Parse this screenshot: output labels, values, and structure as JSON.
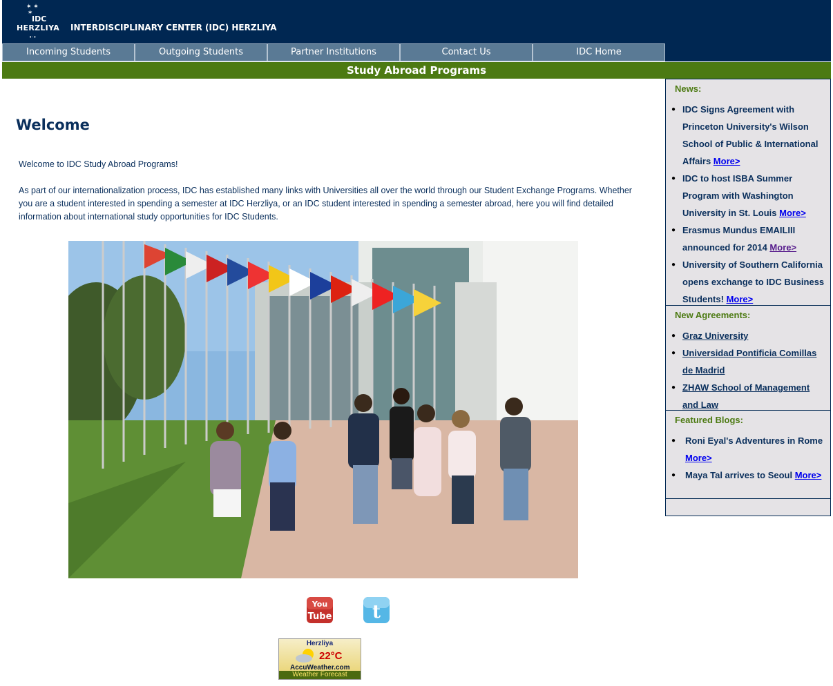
{
  "header": {
    "logo_line1": "IDC",
    "logo_line2": "HERZLIYA",
    "title": "INTERDISCIPLINARY CENTER (IDC) HERZLIYA"
  },
  "nav": [
    "Incoming Students",
    "Outgoing Students",
    "Partner Institutions",
    "Contact Us",
    "IDC Home"
  ],
  "banner": "Study Abroad Programs",
  "main": {
    "heading": "Welcome",
    "intro_1": "Welcome to IDC Study Abroad Programs!",
    "intro_2": "As part of our internationalization process, IDC has established many links with Universities all over the world through our Student Exchange Programs. Whether you are a student interested in spending a semester at IDC Herzliya, or an IDC student interested in spending a semester abroad, here you will find detailed  information about international study opportunities for IDC Students."
  },
  "weather": {
    "city": "Herzliya",
    "temp": "22°C",
    "brand": "AccuWeather.com",
    "forecast": "Weather Forecast"
  },
  "sidebar": {
    "news_heading": "News:",
    "news": [
      {
        "text": "IDC Signs Agreement with Princeton University's Wilson School of Public & International Affairs ",
        "link": "More>"
      },
      {
        "text": "IDC to host ISBA Summer Program with Washington University in St. Louis ",
        "link": "More>"
      },
      {
        "text": "Erasmus Mundus EMAILIII announced for 2014 ",
        "link": "More>"
      },
      {
        "text": "University of Southern California opens exchange to IDC Business Students! ",
        "link": "More>"
      }
    ],
    "agreements_heading": "New Agreements:",
    "agreements": [
      "Graz University",
      "Universidad Pontificia Comillas de Madrid ",
      "ZHAW School of Management and Law"
    ],
    "blogs_heading": "Featured Blogs:",
    "blogs": [
      {
        "text": "Roni Eyal's Adventures in Rome ",
        "link": "More>"
      },
      {
        "text": "Maya Tal arrives to Seoul ",
        "link": "More>"
      }
    ]
  },
  "colors": {
    "header_bg": "#002752",
    "nav_bg": "#5a7a95",
    "banner_bg": "#4c7a12",
    "sidebar_bg": "#e5e3e6",
    "text_blue": "#0a2f5c"
  },
  "icons": [
    "youtube-icon",
    "twitter-icon",
    "weather-sun-cloud-icon"
  ]
}
